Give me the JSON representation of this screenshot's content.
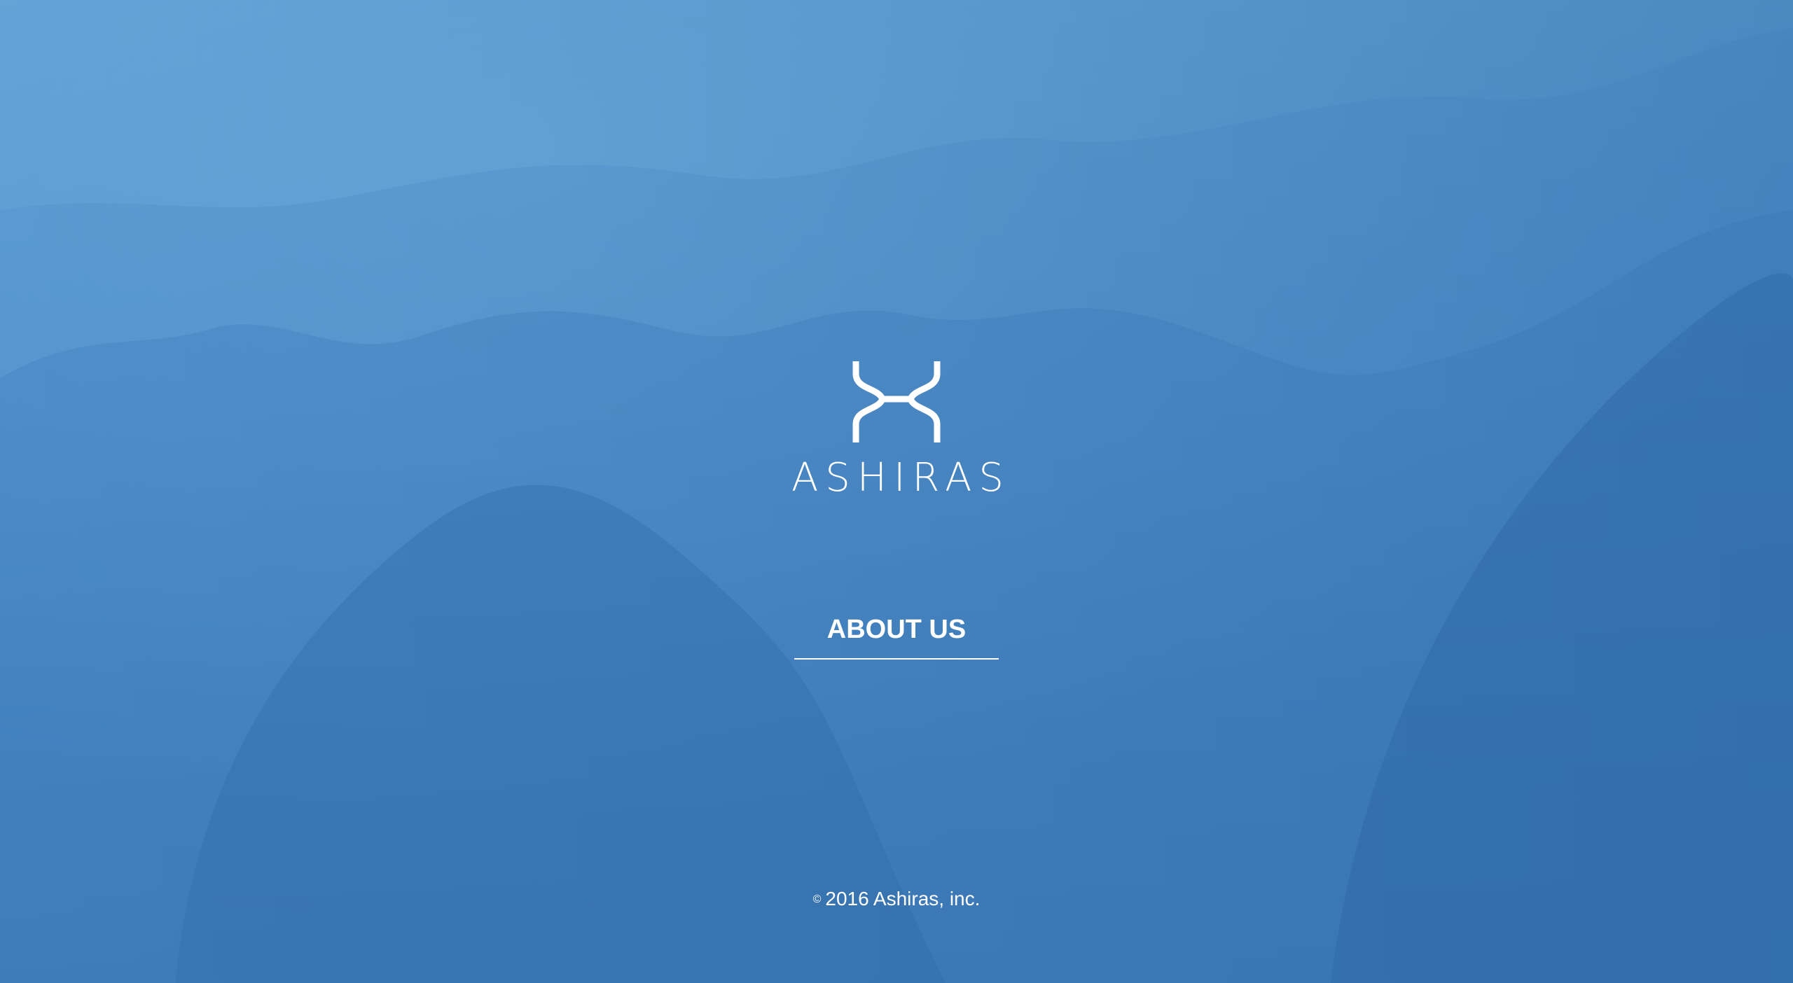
{
  "brand": {
    "name": "ASHIRAS",
    "logo_icon": "ashiras-mark-icon"
  },
  "nav": {
    "about_label": "ABOUT US"
  },
  "footer": {
    "copyright_symbol": "©",
    "copyright_text": "2016 Ashiras, inc."
  },
  "colors": {
    "background_top": "#5d9ed3",
    "background_bottom": "#2f6aa6",
    "foreground": "#ffffff"
  }
}
